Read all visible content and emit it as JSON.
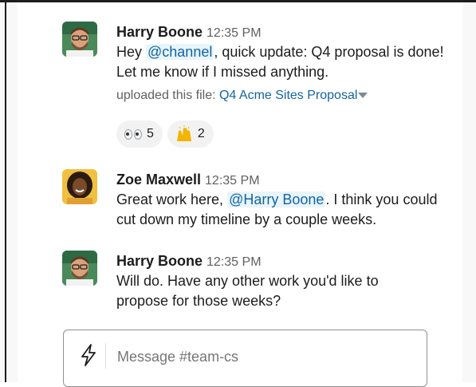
{
  "messages": [
    {
      "sender": "Harry Boone",
      "time": "12:35 PM",
      "text_before": "Hey ",
      "mention": "@channel",
      "text_after": ", quick update: Q4 proposal is done! Let me know if I missed anything.",
      "file_prefix": "uploaded this file: ",
      "file_name": "Q4 Acme Sites Proposal",
      "reactions": [
        {
          "emoji": "eyes-emoji",
          "count": "5"
        },
        {
          "emoji": "raised-hands-emoji",
          "count": "2"
        }
      ]
    },
    {
      "sender": "Zoe Maxwell",
      "time": "12:35 PM",
      "text_before": "Great work here, ",
      "mention": "@Harry Boone",
      "text_after": ". I think you could cut down my timeline by a couple weeks."
    },
    {
      "sender": "Harry Boone",
      "time": "12:35 PM",
      "text": "Will do. Have any other work you'd like to propose for those weeks?"
    }
  ],
  "composer": {
    "placeholder": "Message #team-cs",
    "shortcut_icon": "lightning-bolt-icon"
  },
  "colors": {
    "mention": "#1264a3",
    "mention_bg": "#e8f5fa",
    "link": "#1264a3"
  }
}
